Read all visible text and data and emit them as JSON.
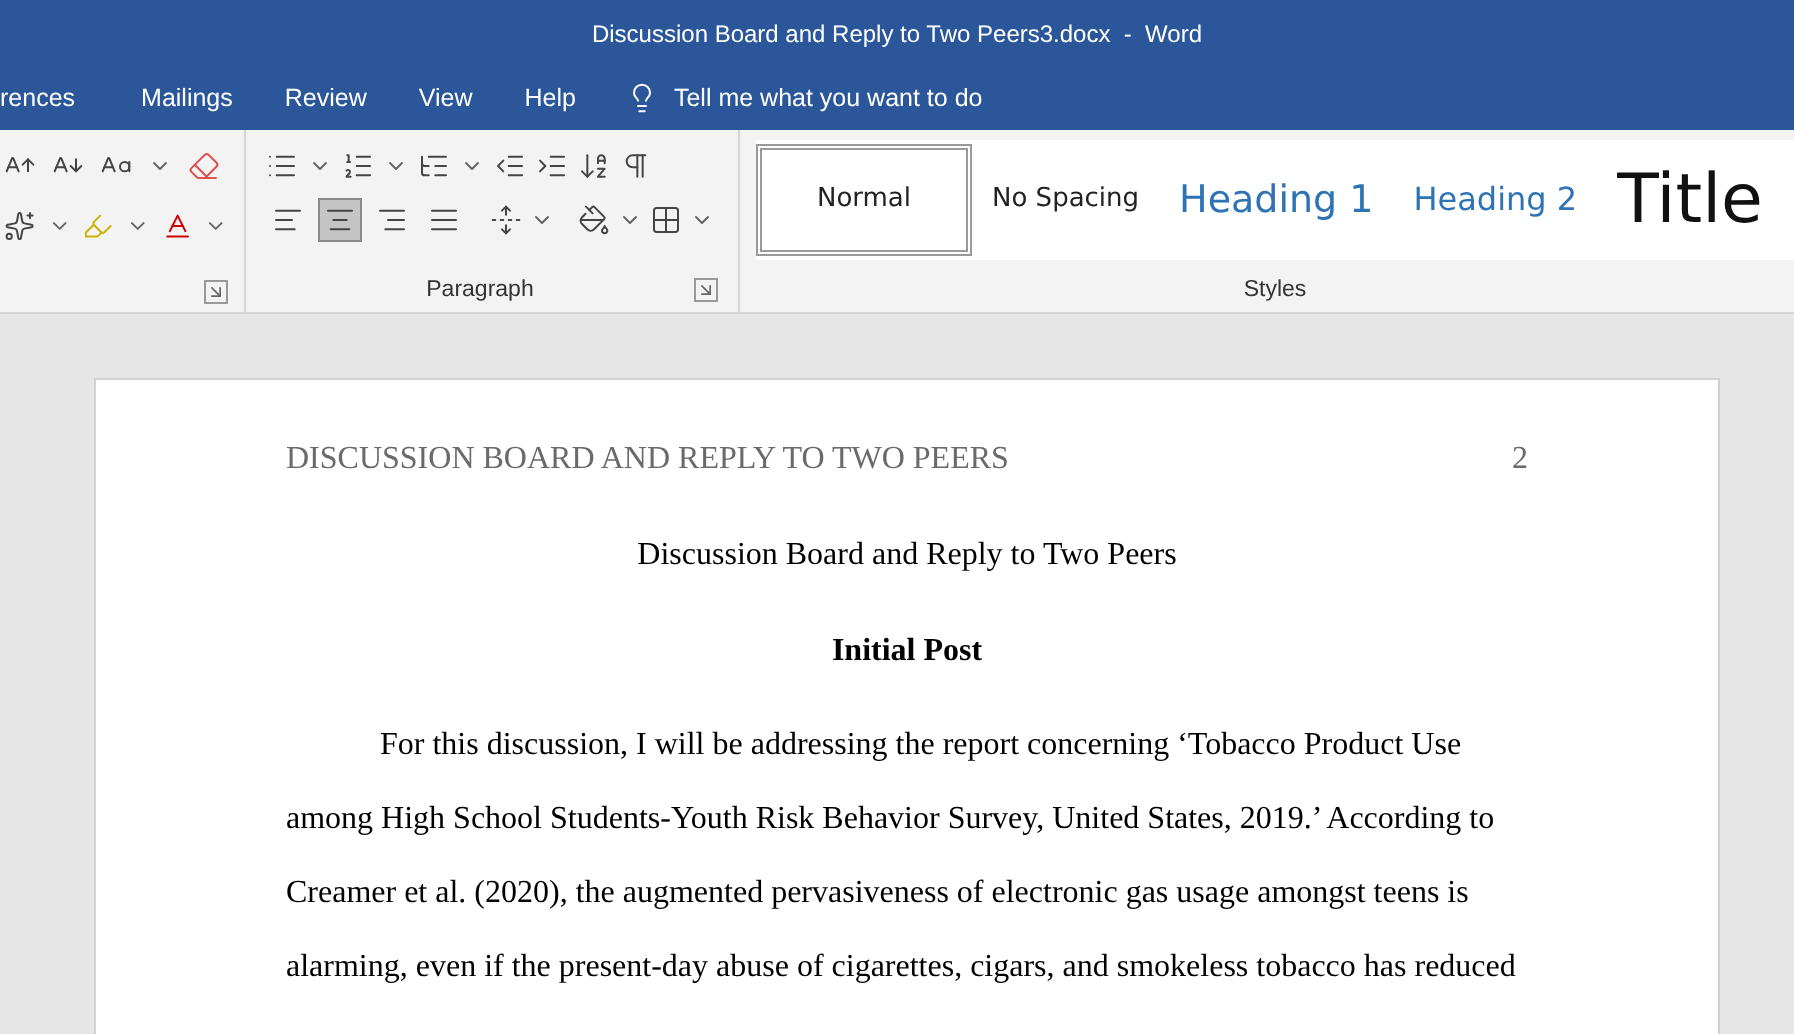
{
  "window": {
    "title": "Discussion Board and Reply to Two Peers3.docx  -  Word"
  },
  "ribbon_tabs": [
    "rences",
    "Mailings",
    "Review",
    "View",
    "Help"
  ],
  "tell_me": {
    "placeholder": "Tell me what you want to do"
  },
  "paragraph_group": {
    "label": "Paragraph",
    "alignments": [
      {
        "kind": "left",
        "selected": false
      },
      {
        "kind": "center",
        "selected": true
      },
      {
        "kind": "right",
        "selected": false
      },
      {
        "kind": "justify",
        "selected": false
      }
    ]
  },
  "styles_group": {
    "label": "Styles",
    "items": [
      {
        "label": "Normal",
        "kind": "normal",
        "selected": true
      },
      {
        "label": "No Spacing",
        "kind": "normal",
        "selected": false
      },
      {
        "label": "Heading 1",
        "kind": "heading1",
        "selected": false
      },
      {
        "label": "Heading 2",
        "kind": "heading2",
        "selected": false
      },
      {
        "label": "Title",
        "kind": "title",
        "selected": false
      }
    ]
  },
  "document": {
    "running_head": "DISCUSSION BOARD AND REPLY TO TWO PEERS",
    "page_number": "2",
    "title": "Discussion Board and Reply to Two Peers",
    "section_heading": "Initial Post",
    "paragraph": "For this discussion, I will be addressing the report concerning ‘Tobacco Product Use among High School Students-Youth Risk Behavior Survey, United States, 2019.’ According to Creamer et al. (2020), the augmented pervasiveness of electronic gas usage amongst teens is alarming, even if the present-day abuse of cigarettes, cigars, and smokeless tobacco has reduced"
  }
}
